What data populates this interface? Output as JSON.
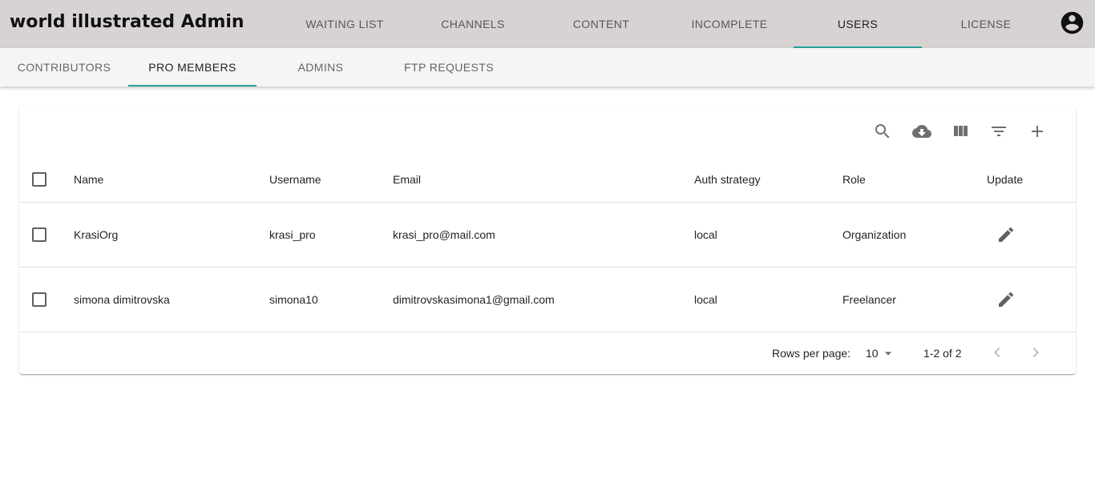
{
  "app": {
    "title": "world illustrated Admin"
  },
  "main_tabs": [
    {
      "label": "WAITING LIST",
      "active": false
    },
    {
      "label": "CHANNELS",
      "active": false
    },
    {
      "label": "CONTENT",
      "active": false
    },
    {
      "label": "INCOMPLETE",
      "active": false
    },
    {
      "label": "USERS",
      "active": true
    },
    {
      "label": "LICENSE",
      "active": false
    }
  ],
  "account_icon": "account-circle-icon",
  "sub_tabs": [
    {
      "label": "CONTRIBUTORS",
      "active": false
    },
    {
      "label": "PRO MEMBERS",
      "active": true
    },
    {
      "label": "ADMINS",
      "active": false
    },
    {
      "label": "FTP REQUESTS",
      "active": false
    }
  ],
  "toolbar": {
    "icons": [
      "search-icon",
      "cloud-download-icon",
      "view-column-icon",
      "filter-icon",
      "add-icon"
    ]
  },
  "table": {
    "headers": {
      "name": "Name",
      "username": "Username",
      "email": "Email",
      "auth": "Auth strategy",
      "role": "Role",
      "update": "Update"
    },
    "rows": [
      {
        "name": "KrasiOrg",
        "username": "krasi_pro",
        "email": "krasi_pro@mail.com",
        "auth": "local",
        "role": "Organization"
      },
      {
        "name": "simona dimitrovska",
        "username": "simona10",
        "email": "dimitrovskasimona1@gmail.com",
        "auth": "local",
        "role": "Freelancer"
      }
    ]
  },
  "pagination": {
    "rows_per_page_label": "Rows per page:",
    "rows_per_page_value": "10",
    "range": "1-2 of 2"
  },
  "colors": {
    "topbar_bg": "#d8d3d3",
    "subbar_bg": "#f5f5f5",
    "accent": "#26a69a"
  }
}
